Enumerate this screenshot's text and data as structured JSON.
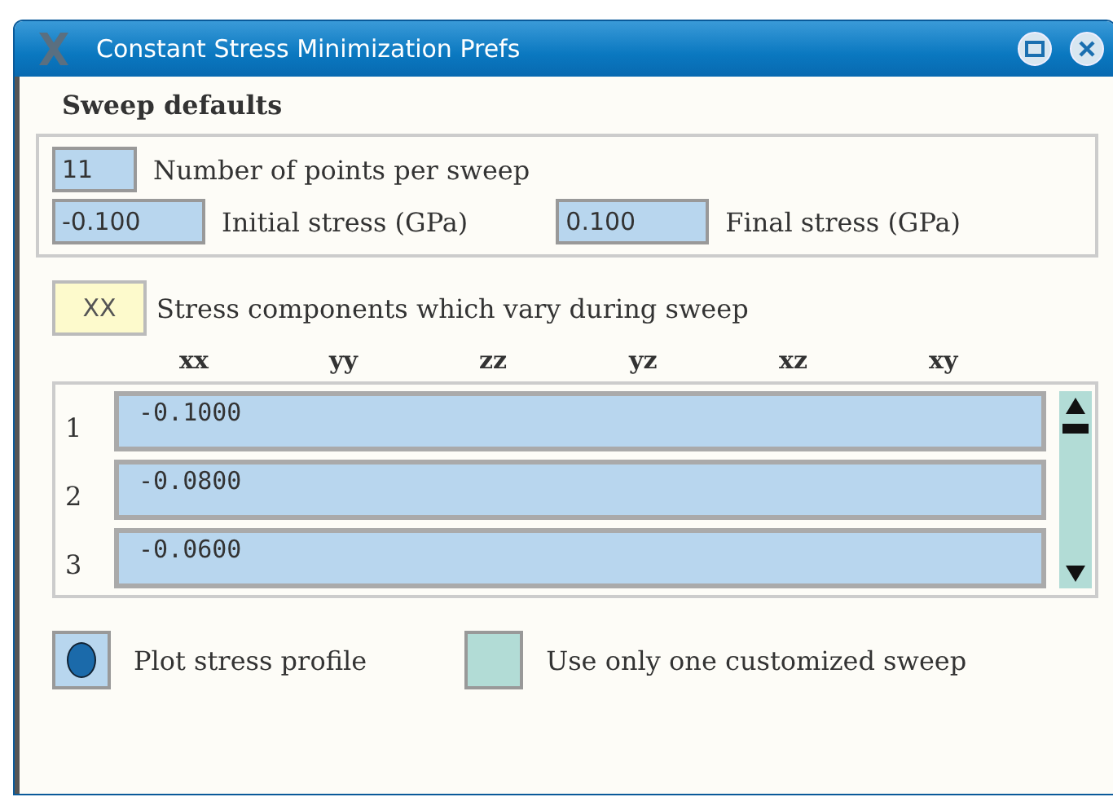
{
  "window": {
    "title": "Constant Stress Minimization Prefs"
  },
  "section": {
    "title": "Sweep defaults"
  },
  "points": {
    "value": "11",
    "label": "Number of points per sweep"
  },
  "initial": {
    "value": "-0.100",
    "label": "Initial stress (GPa)"
  },
  "final": {
    "value": "0.100",
    "label": "Final stress (GPa)"
  },
  "components": {
    "button": "XX",
    "label": "Stress components which vary during sweep"
  },
  "columns": [
    "xx",
    "yy",
    "zz",
    "yz",
    "xz",
    "xy"
  ],
  "rows": [
    {
      "index": "1",
      "value": "-0.1000"
    },
    {
      "index": "2",
      "value": "-0.0800"
    },
    {
      "index": "3",
      "value": "-0.0600"
    }
  ],
  "options": [
    {
      "label": "Plot stress profile",
      "checked": true
    },
    {
      "label": "Use only one customized sweep",
      "checked": false
    }
  ]
}
